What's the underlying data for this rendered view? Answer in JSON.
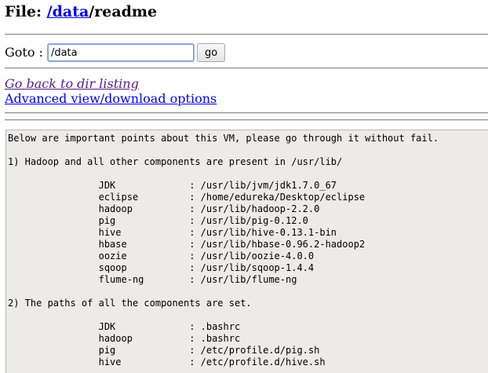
{
  "header": {
    "prefix": "File: ",
    "dir_link": "/data",
    "filename": "/readme"
  },
  "goto": {
    "label": "Goto : ",
    "value": "/data",
    "button": "go"
  },
  "links": {
    "back": "Go back to dir listing",
    "advanced": "Advanced view/download options"
  },
  "file_content": "Below are important points about this VM, please go through it without fail.\n\n1) Hadoop and all other components are present in /usr/lib/\n\n\t\tJDK\t\t: /usr/lib/jvm/jdk1.7.0_67\n\t\teclipse\t\t: /home/edureka/Desktop/eclipse\n\t\thadoop\t\t: /usr/lib/hadoop-2.2.0\n\t\tpig\t\t: /usr/lib/pig-0.12.0\n\t\thive\t\t: /usr/lib/hive-0.13.1-bin\n\t\thbase\t\t: /usr/lib/hbase-0.96.2-hadoop2\n\t\toozie\t\t: /usr/lib/oozie-4.0.0\n\t\tsqoop\t\t: /usr/lib/sqoop-1.4.4\n\t\tflume-ng\t: /usr/lib/flume-ng\n\n2) The paths of all the components are set.\n\n\t\tJDK\t\t: .bashrc\n\t\thadoop\t\t: .bashrc\n\t\tpig\t\t: /etc/profile.d/pig.sh\n\t\thive\t\t: /etc/profile.d/hive.sh"
}
